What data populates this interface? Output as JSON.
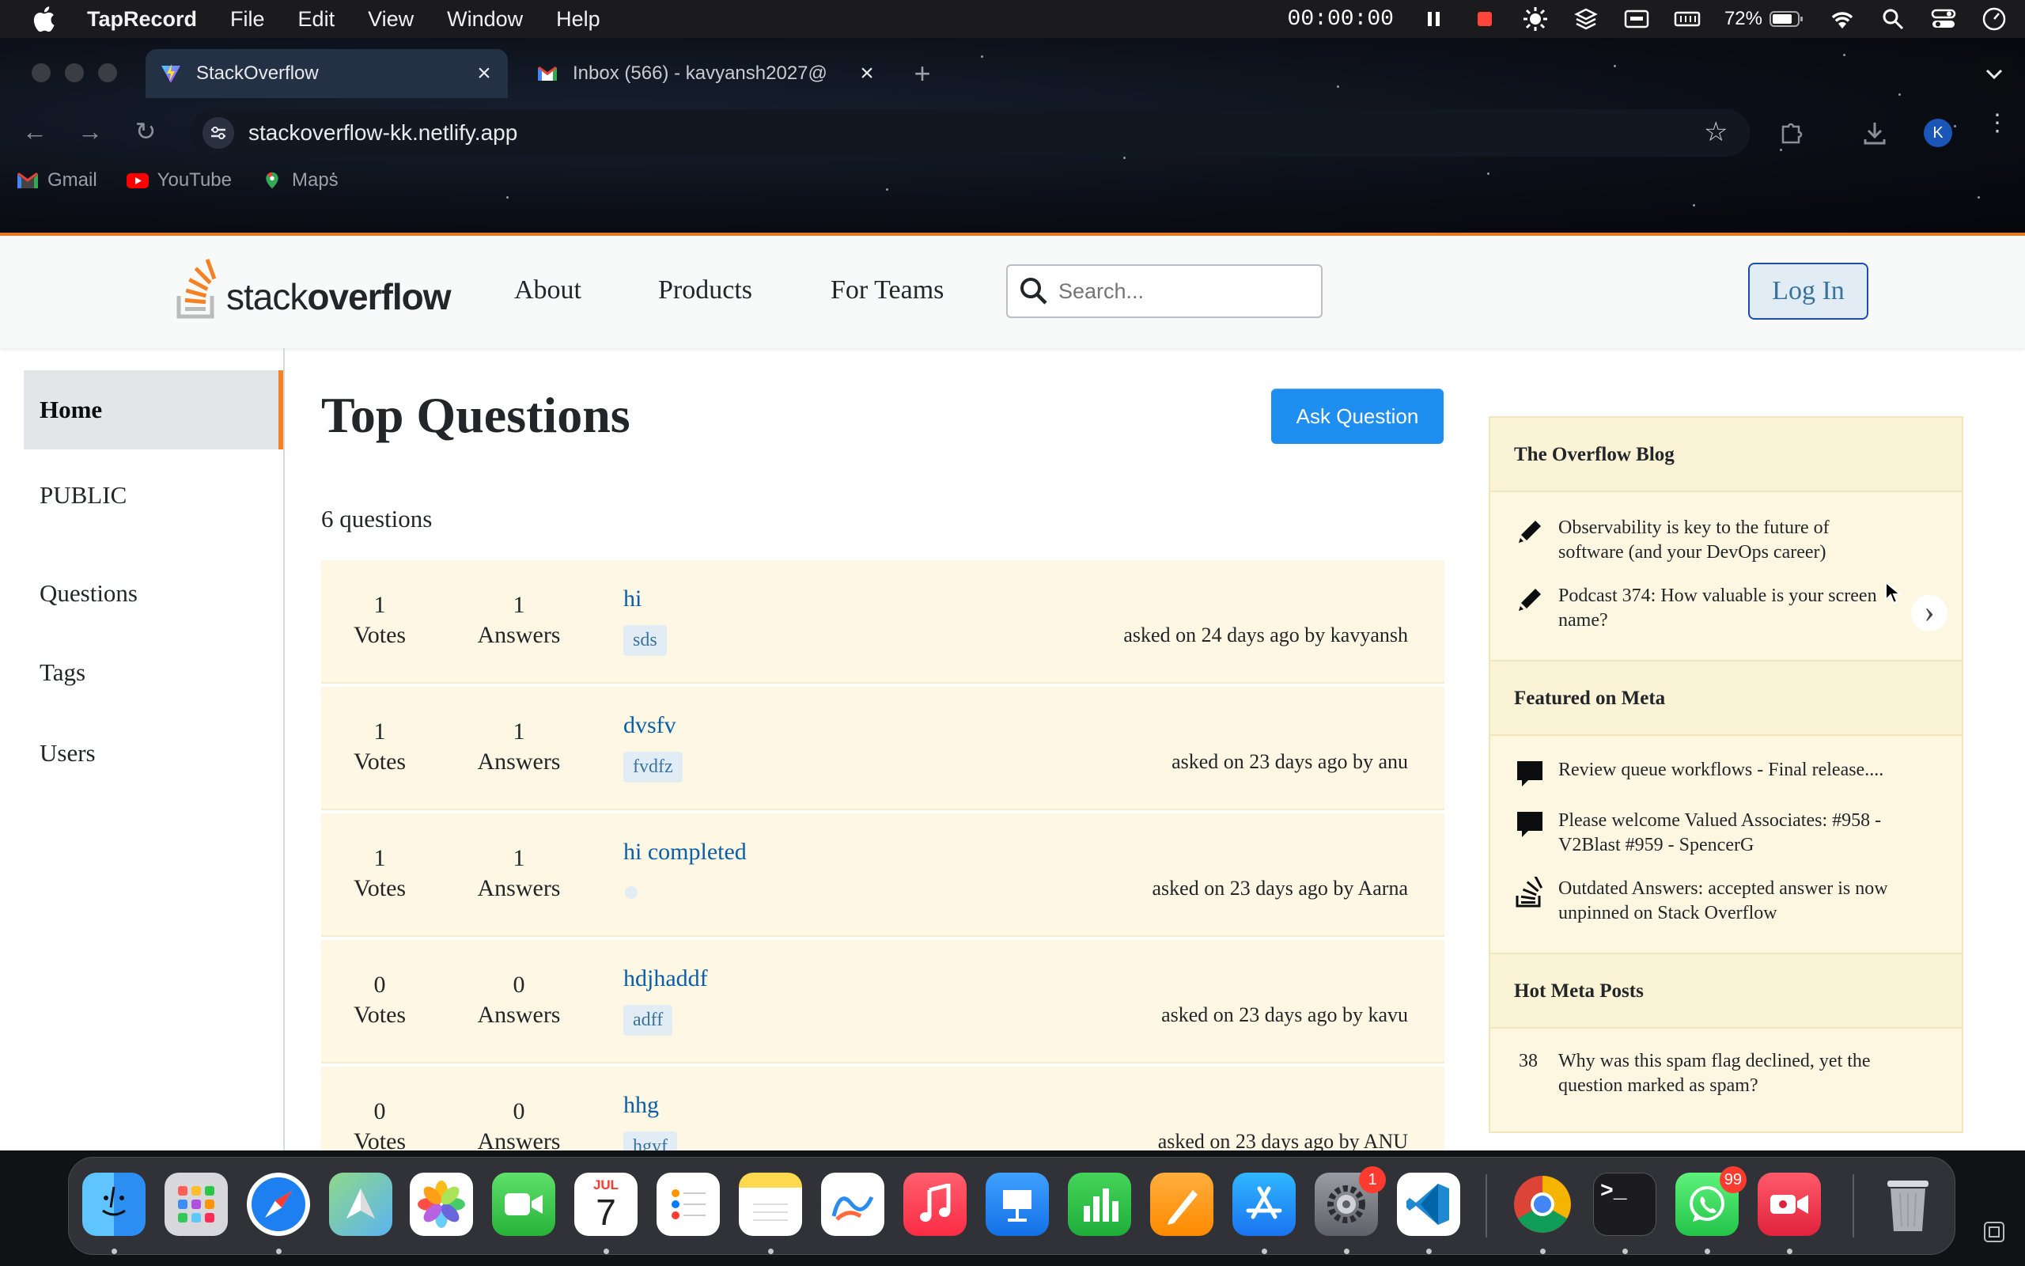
{
  "menubar": {
    "app_name": "TapRecord",
    "items": [
      "File",
      "Edit",
      "View",
      "Window",
      "Help"
    ],
    "timer": "00:00:00",
    "battery": "72%"
  },
  "browser": {
    "tabs": [
      {
        "title": "StackOverflow",
        "favicon": "vite-icon"
      },
      {
        "title": "Inbox (566) - kavyansh2027@",
        "favicon": "gmail-icon"
      }
    ],
    "url": "stackoverflow-kk.netlify.app",
    "profile_initial": "K",
    "bookmarks": [
      {
        "label": "Gmail",
        "icon": "gmail-icon"
      },
      {
        "label": "YouTube",
        "icon": "youtube-icon"
      },
      {
        "label": "Maps",
        "icon": "maps-icon"
      }
    ]
  },
  "header": {
    "logo_prefix": "stack",
    "logo_suffix": "overflow",
    "nav": [
      "About",
      "Products",
      "For Teams"
    ],
    "search_placeholder": "Search...",
    "login_label": "Log In"
  },
  "sidebar": {
    "home": "Home",
    "public": "PUBLIC",
    "items": [
      "Questions",
      "Tags",
      "Users"
    ]
  },
  "main": {
    "title": "Top Questions",
    "ask_button": "Ask Question",
    "count_label": "6 questions",
    "votes_label": "Votes",
    "answers_label": "Answers",
    "questions": [
      {
        "votes": "1",
        "answers": "1",
        "title": "hi",
        "tag": "sds",
        "meta": "asked on 24 days ago by kavyansh"
      },
      {
        "votes": "1",
        "answers": "1",
        "title": "dvsfv",
        "tag": "fvdfz",
        "meta": "asked on 23 days ago by anu"
      },
      {
        "votes": "1",
        "answers": "1",
        "title": "hi completed",
        "tag": "",
        "meta": "asked on 23 days ago by Aarna"
      },
      {
        "votes": "0",
        "answers": "0",
        "title": "hdjhaddf",
        "tag": "adff",
        "meta": "asked on 23 days ago by kavu"
      },
      {
        "votes": "0",
        "answers": "0",
        "title": "hhg",
        "tag": "hgyf",
        "meta": "asked on 23 days ago by ANU"
      }
    ]
  },
  "rightbar": {
    "blog_title": "The Overflow Blog",
    "blog_items": [
      "Observability is key to the future of software (and your DevOps career)",
      "Podcast 374: How valuable is your screen name?"
    ],
    "meta_title": "Featured on Meta",
    "meta_items": [
      {
        "text": "Review queue workflows - Final release....",
        "icon": "comment-icon"
      },
      {
        "text": "Please welcome Valued Associates: #958 - V2Blast #959 - SpencerG",
        "icon": "comment-icon"
      },
      {
        "text": "Outdated Answers: accepted answer is now unpinned on Stack Overflow",
        "icon": "stackoverflow-icon"
      }
    ],
    "hot_title": "Hot Meta Posts",
    "hot_items": [
      {
        "count": "38",
        "text": "Why was this spam flag declined, yet the question marked as spam?"
      }
    ]
  },
  "dock": {
    "apps": [
      "Finder",
      "Launchpad",
      "Safari",
      "Maps",
      "Photos",
      "FaceTime",
      "Calendar",
      "Reminders",
      "Notes",
      "Freeform",
      "Music",
      "Keynote",
      "Numbers",
      "Pages",
      "App Store",
      "System Settings",
      "VS Code",
      "Chrome",
      "Terminal",
      "WhatsApp",
      "Recorder",
      "Trash"
    ],
    "calendar_month": "JUL",
    "calendar_day": "7",
    "settings_badge": "1",
    "whatsapp_badge": "99"
  }
}
